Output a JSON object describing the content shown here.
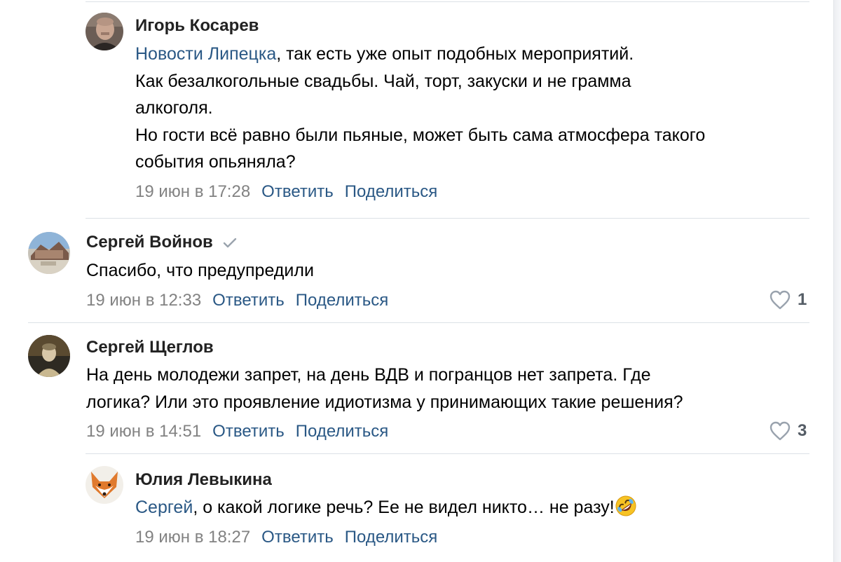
{
  "comments": [
    {
      "author": "Игорь Косарев",
      "mention": "Новости Липецка",
      "lines": [
        ", так есть уже опыт подобных мероприятий.",
        "Как безалкогольные свадьбы. Чай, торт, закуски и не грамма",
        "алкоголя.",
        "Но гости всё равно были пьяные, может быть сама атмосфера такого",
        "события опьяняла?"
      ],
      "date": "19 июн в 17:28",
      "reply_label": "Ответить",
      "share_label": "Поделиться"
    },
    {
      "author": "Сергей Войнов",
      "verified_icon": "checkmark-icon",
      "lines": [
        "Спасибо, что предупредили"
      ],
      "date": "19 июн в 12:33",
      "reply_label": "Ответить",
      "share_label": "Поделиться",
      "likes": "1"
    },
    {
      "author": "Сергей Щеглов",
      "lines": [
        "На день молодежи запрет, на день ВДВ и погранцов нет запрета. Где",
        "логика? Или это проявление идиотизма у принимающих такие решения?"
      ],
      "date": "19 июн в 14:51",
      "reply_label": "Ответить",
      "share_label": "Поделиться",
      "likes": "3"
    },
    {
      "author": "Юлия Левыкина",
      "mention": "Сергей",
      "lines": [
        ", о какой логике речь? Ее не видел никто… не разу!"
      ],
      "emoji": "rolling-on-floor-laughing-emoji",
      "date": "19 июн в 18:27",
      "reply_label": "Ответить",
      "share_label": "Поделиться"
    }
  ],
  "colors": {
    "link": "#2a5885",
    "meta_gray": "#828282",
    "separator": "#dce1e6",
    "likes_gray": "#555d66"
  }
}
